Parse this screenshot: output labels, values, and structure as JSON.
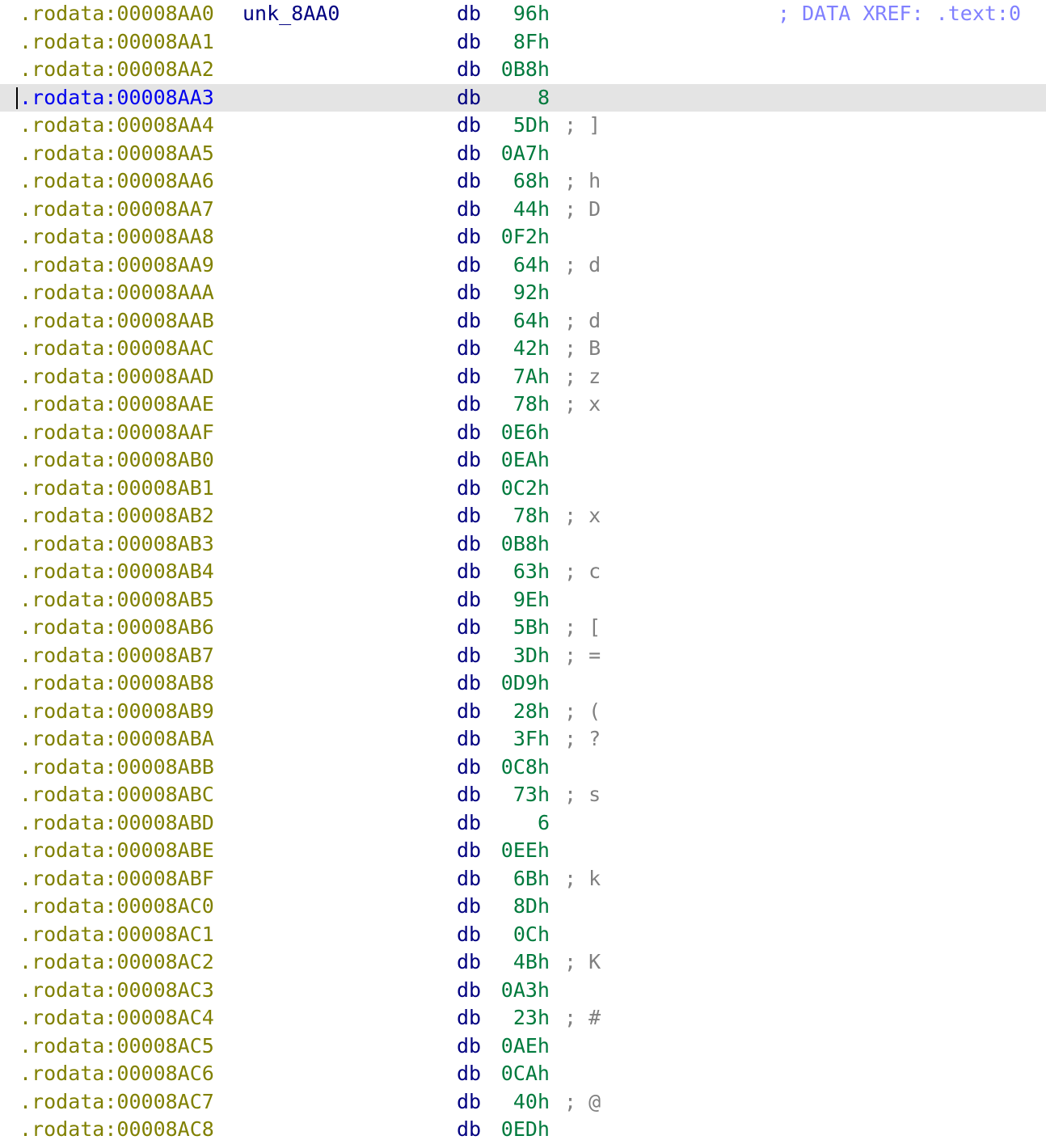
{
  "label": "unk_8AA0",
  "xref": "; DATA XREF: .text:0",
  "selected_index": 3,
  "mnemonic": "db",
  "rows": [
    {
      "addr": ".rodata:00008AA0",
      "op": "96h",
      "cmt": ""
    },
    {
      "addr": ".rodata:00008AA1",
      "op": "8Fh",
      "cmt": ""
    },
    {
      "addr": ".rodata:00008AA2",
      "op": "0B8h",
      "cmt": ""
    },
    {
      "addr": ".rodata:00008AA3",
      "op": "8",
      "cmt": ""
    },
    {
      "addr": ".rodata:00008AA4",
      "op": "5Dh",
      "cmt": "; ]"
    },
    {
      "addr": ".rodata:00008AA5",
      "op": "0A7h",
      "cmt": ""
    },
    {
      "addr": ".rodata:00008AA6",
      "op": "68h",
      "cmt": "; h"
    },
    {
      "addr": ".rodata:00008AA7",
      "op": "44h",
      "cmt": "; D"
    },
    {
      "addr": ".rodata:00008AA8",
      "op": "0F2h",
      "cmt": ""
    },
    {
      "addr": ".rodata:00008AA9",
      "op": "64h",
      "cmt": "; d"
    },
    {
      "addr": ".rodata:00008AAA",
      "op": "92h",
      "cmt": ""
    },
    {
      "addr": ".rodata:00008AAB",
      "op": "64h",
      "cmt": "; d"
    },
    {
      "addr": ".rodata:00008AAC",
      "op": "42h",
      "cmt": "; B"
    },
    {
      "addr": ".rodata:00008AAD",
      "op": "7Ah",
      "cmt": "; z"
    },
    {
      "addr": ".rodata:00008AAE",
      "op": "78h",
      "cmt": "; x"
    },
    {
      "addr": ".rodata:00008AAF",
      "op": "0E6h",
      "cmt": ""
    },
    {
      "addr": ".rodata:00008AB0",
      "op": "0EAh",
      "cmt": ""
    },
    {
      "addr": ".rodata:00008AB1",
      "op": "0C2h",
      "cmt": ""
    },
    {
      "addr": ".rodata:00008AB2",
      "op": "78h",
      "cmt": "; x"
    },
    {
      "addr": ".rodata:00008AB3",
      "op": "0B8h",
      "cmt": ""
    },
    {
      "addr": ".rodata:00008AB4",
      "op": "63h",
      "cmt": "; c"
    },
    {
      "addr": ".rodata:00008AB5",
      "op": "9Eh",
      "cmt": ""
    },
    {
      "addr": ".rodata:00008AB6",
      "op": "5Bh",
      "cmt": "; ["
    },
    {
      "addr": ".rodata:00008AB7",
      "op": "3Dh",
      "cmt": "; ="
    },
    {
      "addr": ".rodata:00008AB8",
      "op": "0D9h",
      "cmt": ""
    },
    {
      "addr": ".rodata:00008AB9",
      "op": "28h",
      "cmt": "; ("
    },
    {
      "addr": ".rodata:00008ABA",
      "op": "3Fh",
      "cmt": "; ?"
    },
    {
      "addr": ".rodata:00008ABB",
      "op": "0C8h",
      "cmt": ""
    },
    {
      "addr": ".rodata:00008ABC",
      "op": "73h",
      "cmt": "; s"
    },
    {
      "addr": ".rodata:00008ABD",
      "op": "6",
      "cmt": ""
    },
    {
      "addr": ".rodata:00008ABE",
      "op": "0EEh",
      "cmt": ""
    },
    {
      "addr": ".rodata:00008ABF",
      "op": "6Bh",
      "cmt": "; k"
    },
    {
      "addr": ".rodata:00008AC0",
      "op": "8Dh",
      "cmt": ""
    },
    {
      "addr": ".rodata:00008AC1",
      "op": "0Ch",
      "cmt": ""
    },
    {
      "addr": ".rodata:00008AC2",
      "op": "4Bh",
      "cmt": "; K"
    },
    {
      "addr": ".rodata:00008AC3",
      "op": "0A3h",
      "cmt": ""
    },
    {
      "addr": ".rodata:00008AC4",
      "op": "23h",
      "cmt": "; #"
    },
    {
      "addr": ".rodata:00008AC5",
      "op": "0AEh",
      "cmt": ""
    },
    {
      "addr": ".rodata:00008AC6",
      "op": "0CAh",
      "cmt": ""
    },
    {
      "addr": ".rodata:00008AC7",
      "op": "40h",
      "cmt": "; @"
    },
    {
      "addr": ".rodata:00008AC8",
      "op": "0EDh",
      "cmt": ""
    }
  ]
}
